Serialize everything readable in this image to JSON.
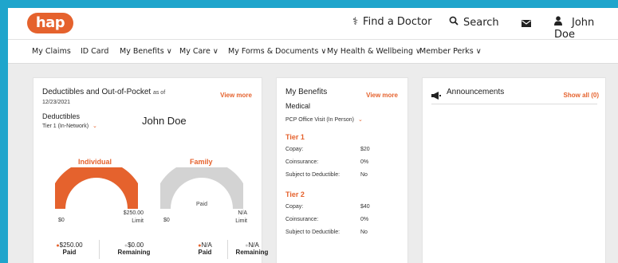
{
  "app": {
    "logo_text": "hap"
  },
  "topbar": {
    "find_doctor": "Find a Doctor",
    "search": "Search",
    "user_name": "John Doe",
    "icons": {
      "find_doctor": "stethoscope-icon",
      "search": "search-icon",
      "mail": "mail-icon",
      "user": "user-icon"
    }
  },
  "nav": {
    "items": [
      {
        "label": "My Claims"
      },
      {
        "label": "ID Card"
      },
      {
        "label": "My Benefits ∨"
      },
      {
        "label": "My Care ∨"
      },
      {
        "label": "My Forms & Documents ∨"
      },
      {
        "label": "My Health & Wellbeing ∨"
      },
      {
        "label": "Member Perks ∨"
      }
    ]
  },
  "deductibles": {
    "title": "Deductibles and Out-of-Pocket",
    "as_of": "as of",
    "date": "12/23/2021",
    "view_more": "View more",
    "subtitle": "Deductibles",
    "member_name": "John Doe",
    "tier_select": "Tier 1 (In-Network)",
    "individual": {
      "label": "Individual",
      "amount": "$250.00",
      "amount_caption": "Paid",
      "fill_fraction": 1.0,
      "min": "$0",
      "max": "$250.00",
      "max_caption": "Limit",
      "paid": "$250.00",
      "paid_caption": "Paid",
      "remaining": "$0.00",
      "remaining_caption": "Remaining"
    },
    "family": {
      "label": "Family",
      "amount": "N/A",
      "amount_caption": "Paid",
      "fill_fraction": 0,
      "min": "$0",
      "max": "N/A",
      "max_caption": "Limit",
      "paid": "N/A",
      "paid_caption": "Paid",
      "remaining": "N/A",
      "remaining_caption": "Remaining"
    },
    "colors": {
      "accent": "#e5622d",
      "gauge_empty": "#d3d3d3"
    }
  },
  "benefits": {
    "title": "My Benefits",
    "view_more": "View more",
    "category": "Medical",
    "select": "PCP Office Visit (In Person)",
    "tiers": [
      {
        "name": "Tier 1",
        "rows": [
          {
            "label": "Copay:",
            "value": "$20"
          },
          {
            "label": "Coinsurance:",
            "value": "0%"
          },
          {
            "label": "Subject to Deductible:",
            "value": "No"
          }
        ]
      },
      {
        "name": "Tier 2",
        "rows": [
          {
            "label": "Copay:",
            "value": "$40"
          },
          {
            "label": "Coinsurance:",
            "value": "0%"
          },
          {
            "label": "Subject to Deductible:",
            "value": "No"
          }
        ]
      }
    ]
  },
  "announcements": {
    "title": "Announcements",
    "show_all": "Show all (0)",
    "icon": "megaphone-icon"
  }
}
